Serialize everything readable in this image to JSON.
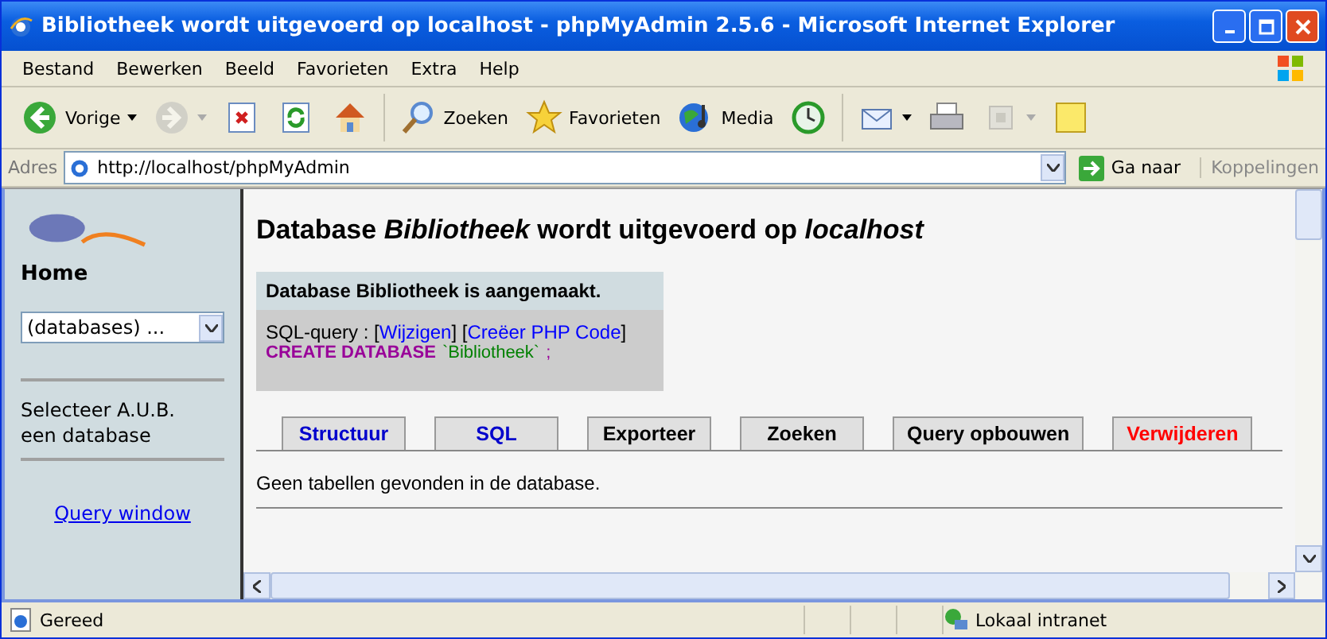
{
  "window": {
    "title": "Bibliotheek wordt uitgevoerd op localhost - phpMyAdmin 2.5.6 - Microsoft Internet Explorer"
  },
  "menu": [
    "Bestand",
    "Bewerken",
    "Beeld",
    "Favorieten",
    "Extra",
    "Help"
  ],
  "toolbar": [
    {
      "kind": "back",
      "label": "Vorige",
      "dropdown": true,
      "disabled": false
    },
    {
      "kind": "forward",
      "dropdown": true,
      "disabled": true
    },
    {
      "kind": "stop",
      "disabled": false
    },
    {
      "kind": "refresh",
      "disabled": false
    },
    {
      "kind": "home",
      "disabled": false
    },
    {
      "kind": "search",
      "label": "Zoeken",
      "disabled": false
    },
    {
      "kind": "favorites",
      "label": "Favorieten",
      "disabled": false
    },
    {
      "kind": "media",
      "label": "Media",
      "disabled": false
    },
    {
      "kind": "history",
      "disabled": false
    },
    {
      "kind": "mail",
      "dropdown": true,
      "disabled": false
    },
    {
      "kind": "print",
      "disabled": false
    },
    {
      "kind": "edit",
      "dropdown": true,
      "disabled": true
    },
    {
      "kind": "note",
      "disabled": false
    }
  ],
  "address": {
    "label": "Adres",
    "value": "http://localhost/phpMyAdmin",
    "go": "Ga naar",
    "links": "Koppelingen"
  },
  "sidebar": {
    "home": "Home",
    "select": "(databases) ...",
    "hint": "Selecteer A.U.B. een database",
    "query_window": "Query window"
  },
  "main": {
    "heading": "Database *Bibliotheek* wordt uitgevoerd op *localhost*",
    "message": "Database Bibliotheek is aangemaakt.",
    "sql_line": [
      {
        "kind": "text",
        "text": "SQL-query : ["
      },
      {
        "kind": "link",
        "text": "Wijzigen"
      },
      {
        "kind": "text",
        "text": "] ["
      },
      {
        "kind": "link",
        "text": "Creëer PHP Code"
      },
      {
        "kind": "text",
        "text": "]"
      }
    ],
    "code": [
      {
        "kind": "keyword",
        "text": "CREATE DATABASE"
      },
      {
        "kind": "string",
        "text": "`Bibliotheek`"
      },
      {
        "kind": "punct",
        "text": ";"
      }
    ],
    "tabs": [
      {
        "label": "Structuur",
        "color": "#0000cc"
      },
      {
        "label": "SQL",
        "color": "#0000cc"
      },
      {
        "label": "Exporteer",
        "color": "#000000"
      },
      {
        "label": "Zoeken",
        "color": "#000000"
      },
      {
        "label": "Query opbouwen",
        "color": "#000000"
      },
      {
        "label": "Verwijderen",
        "color": "#ff0000"
      }
    ],
    "notice": "Geen tabellen gevonden in de database."
  },
  "status_bar": {
    "text": "Gereed",
    "zone": "Lokaal intranet"
  }
}
